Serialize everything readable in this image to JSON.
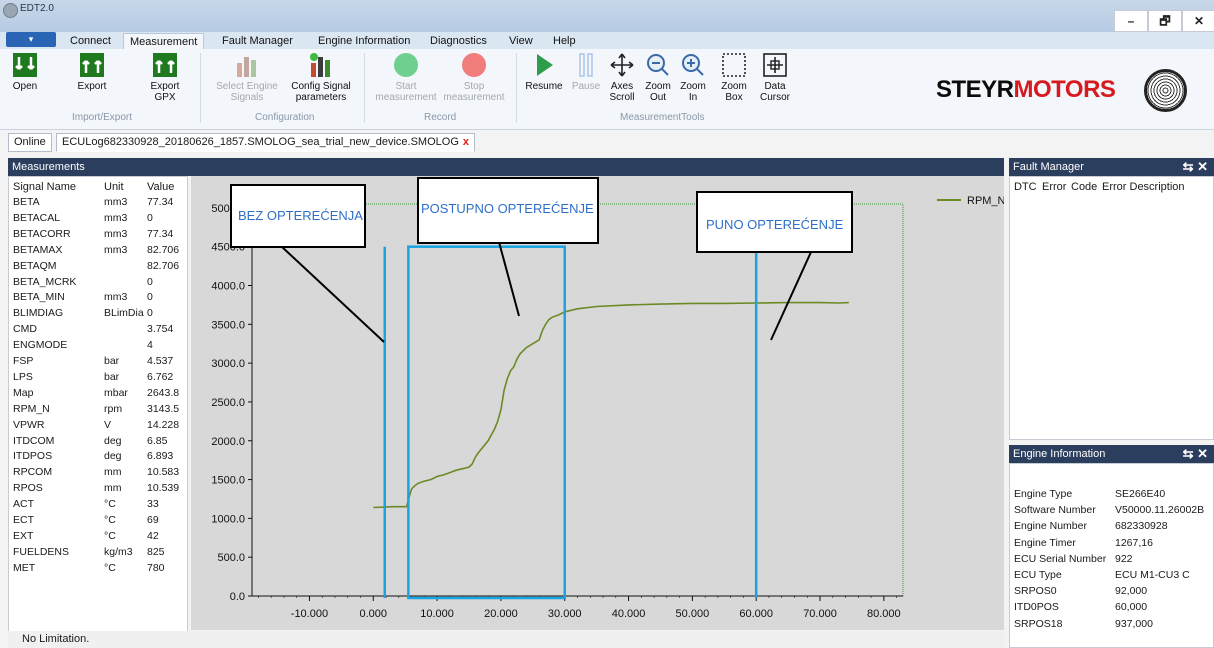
{
  "app_title": "EDT2.0",
  "window_controls": {
    "minimize": "–",
    "maximize": "🗗",
    "close": "✕"
  },
  "menu": {
    "app_button": "▾",
    "tabs": [
      {
        "label": "Connect"
      },
      {
        "label": "Measurement",
        "active": true
      },
      {
        "label": "Fault Manager"
      },
      {
        "label": "Engine Information"
      },
      {
        "label": "Diagnostics"
      },
      {
        "label": "View"
      },
      {
        "label": "Help"
      }
    ]
  },
  "ribbon": {
    "buttons": [
      {
        "label": "Open",
        "icon": "open-log-icon",
        "enabled": true
      },
      {
        "label": "Export",
        "icon": "export-icon",
        "enabled": true
      },
      {
        "label": "Export GPX",
        "icon": "export-gpx-icon",
        "enabled": true
      },
      {
        "label": "Select Engine Signals",
        "icon": "select-signals-icon",
        "enabled": false
      },
      {
        "label": "Config Signal parameters",
        "icon": "config-signal-icon",
        "enabled": true
      },
      {
        "label": "Start measurement",
        "icon": "start-record-icon",
        "enabled": false
      },
      {
        "label": "Stop measurement",
        "icon": "stop-record-icon",
        "enabled": false
      },
      {
        "label": "Resume",
        "icon": "play-icon",
        "enabled": true
      },
      {
        "label": "Pause",
        "icon": "pause-icon",
        "enabled": false
      },
      {
        "label": "Axes Scroll",
        "icon": "move-arrows-icon",
        "enabled": true
      },
      {
        "label": "Zoom Out",
        "icon": "zoom-out-icon",
        "enabled": true
      },
      {
        "label": "Zoom In",
        "icon": "zoom-in-icon",
        "enabled": true
      },
      {
        "label": "Zoom Box",
        "icon": "zoom-box-icon",
        "enabled": true
      },
      {
        "label": "Data Cursor",
        "icon": "data-cursor-icon",
        "enabled": true
      }
    ],
    "groups": [
      "Import/Export",
      "Configuration",
      "Record",
      "MeasurementTools"
    ]
  },
  "brand": {
    "part1": "STEYR",
    "part2": "MOTORS",
    "color_dark": "#0b0b0b",
    "color_red": "#d71920"
  },
  "doc_tabs": {
    "online": "Online",
    "file": "ECULog682330928_20180626_1857.SMOLOG_sea_trial_new_device.SMOLOG",
    "close": "x"
  },
  "measurements": {
    "title": "Measurements",
    "columns": [
      "Signal Name",
      "Unit",
      "Value"
    ],
    "rows": [
      [
        "BETA",
        "mm3",
        "77.34"
      ],
      [
        "BETACAL",
        "mm3",
        "0"
      ],
      [
        "BETACORR",
        "mm3",
        "77.34"
      ],
      [
        "BETAMAX",
        "mm3",
        "82.706"
      ],
      [
        "BETAQM",
        "",
        "82.706"
      ],
      [
        "BETA_MCRK",
        "",
        "0"
      ],
      [
        "BETA_MIN",
        "mm3",
        "0"
      ],
      [
        "BLIMDIAG",
        "BLimDia",
        "0"
      ],
      [
        "CMD",
        "",
        "3.754"
      ],
      [
        "ENGMODE",
        "",
        "4"
      ],
      [
        "FSP",
        "bar",
        "4.537"
      ],
      [
        "LPS",
        "bar",
        "6.762"
      ],
      [
        "Map",
        "mbar",
        "2643.8"
      ],
      [
        "RPM_N",
        "rpm",
        "3143.5"
      ],
      [
        "VPWR",
        "V",
        "14.228"
      ],
      [
        "ITDCOM",
        "deg",
        "6.85"
      ],
      [
        "ITDPOS",
        "deg",
        "6.893"
      ],
      [
        "RPCOM",
        "mm",
        "10.583"
      ],
      [
        "RPOS",
        "mm",
        "10.539"
      ],
      [
        "ACT",
        "°C",
        "33"
      ],
      [
        "ECT",
        "°C",
        "69"
      ],
      [
        "EXT",
        "°C",
        "42"
      ],
      [
        "FUELDENS",
        "kg/m3",
        "825"
      ],
      [
        "MET",
        "°C",
        "780"
      ]
    ]
  },
  "status_text": "No Limitation.",
  "fault_manager": {
    "title": "Fault Manager",
    "columns": [
      "DTC",
      "Error",
      "Code",
      "Error Description"
    ]
  },
  "engine_info": {
    "title": "Engine Information",
    "rows": [
      [
        "Engine Type",
        "SE266E40"
      ],
      [
        "Software Number",
        "V50000.11.26002B"
      ],
      [
        "Engine Number",
        "682330928"
      ],
      [
        "Engine Timer",
        "1267,16"
      ],
      [
        "ECU Serial Number",
        "922"
      ],
      [
        "ECU Type",
        "ECU M1-CU3 C"
      ],
      [
        "SRPOS0",
        "92,000"
      ],
      [
        "ITD0POS",
        "60,000"
      ],
      [
        "SRPOS18",
        "937,000"
      ]
    ]
  },
  "panel_icons": {
    "pin": "⇆",
    "close": "✕"
  },
  "annotations": {
    "no_load": "BEZ OPTEREĆENJA",
    "gradual_load": "POSTUPNO OPTEREĆENJE",
    "full_load": "PUNO OPTEREĆENJE"
  },
  "chart_data": {
    "type": "line",
    "x_ticks": [
      "-10.000",
      "0.000",
      "10.000",
      "20.000",
      "30.000",
      "40.000",
      "50.000",
      "60.000",
      "70.000",
      "80.000"
    ],
    "y_ticks": [
      "0.0",
      "500.0",
      "1000.0",
      "1500.0",
      "2000.0",
      "2500.0",
      "3000.0",
      "3500.0",
      "4000.0",
      "4500.0",
      "5000.0"
    ],
    "xlim": [
      -19,
      83
    ],
    "ylim": [
      0,
      5050
    ],
    "series": [
      {
        "name": "RPM_N",
        "color": "#6b8a24",
        "x": [
          0,
          3,
          5.2,
          5.6,
          6,
          6.5,
          7,
          8,
          9,
          10,
          11,
          12,
          13,
          14,
          15,
          15.5,
          16,
          16.5,
          17,
          18,
          19,
          19.5,
          20,
          20.5,
          21,
          21.5,
          22,
          22.5,
          23,
          24,
          25,
          26,
          26.5,
          27,
          27.5,
          28,
          29,
          30,
          32,
          35,
          40,
          45,
          50,
          55,
          60,
          65,
          70,
          73,
          74.5
        ],
        "y": [
          1140,
          1150,
          1150,
          1270,
          1380,
          1420,
          1450,
          1480,
          1500,
          1540,
          1560,
          1590,
          1620,
          1640,
          1660,
          1700,
          1790,
          1850,
          1900,
          2000,
          2150,
          2250,
          2400,
          2650,
          2800,
          2900,
          2950,
          3050,
          3120,
          3200,
          3250,
          3300,
          3420,
          3500,
          3560,
          3590,
          3620,
          3660,
          3700,
          3730,
          3750,
          3760,
          3770,
          3770,
          3775,
          3780,
          3780,
          3775,
          3780
        ]
      }
    ],
    "vlines_x": [
      1.8,
      60
    ],
    "load_box": [
      5.5,
      30
    ],
    "box_top": 4500
  }
}
